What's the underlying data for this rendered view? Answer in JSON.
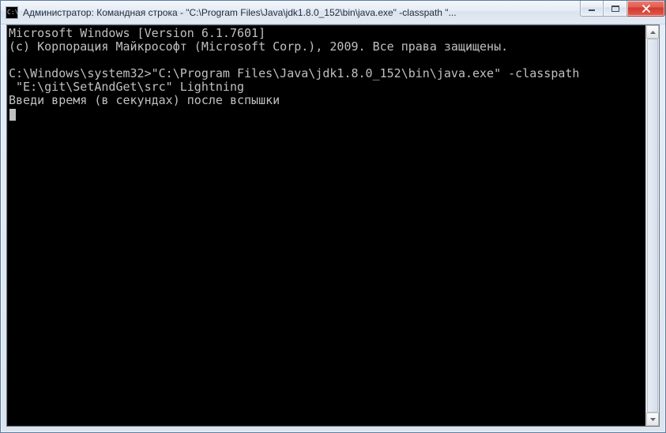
{
  "window": {
    "title": "Администратор: Командная строка - \"C:\\Program Files\\Java\\jdk1.8.0_152\\bin\\java.exe\"  -classpath \"..."
  },
  "terminal": {
    "line1": "Microsoft Windows [Version 6.1.7601]",
    "line2": "(c) Корпорация Майкрософт (Microsoft Corp.), 2009. Все права защищены.",
    "blank1": "",
    "line3": "C:\\Windows\\system32>\"C:\\Program Files\\Java\\jdk1.8.0_152\\bin\\java.exe\" -classpath",
    "line4": " \"E:\\git\\SetAndGet\\src\" Lightning",
    "line5": "Введи время (в секундах) после вспышки"
  }
}
